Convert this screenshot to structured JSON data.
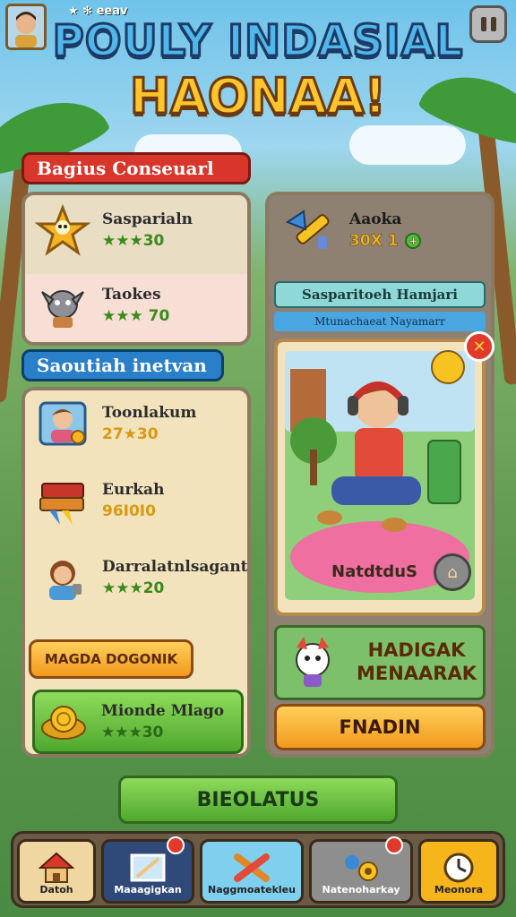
{
  "header": {
    "badge_text": "★ ✻ eeav",
    "title_line1": "POULY INDASIAL",
    "title_line2": "HAONAA!"
  },
  "left_panel": {
    "ribbon1": "Bagius Conseuarl",
    "items_top": [
      {
        "name": "Sasparialn",
        "stat": "★★★30",
        "icon": "star-creature-icon"
      },
      {
        "name": "Taokes",
        "stat": "★★★ 70",
        "icon": "goat-icon"
      }
    ],
    "ribbon2": "Saoutiah inetvan",
    "items_bottom": [
      {
        "name": "Toonlakum",
        "stat": "27★30",
        "icon": "boy-portrait-icon"
      },
      {
        "name": "Eurkah",
        "stat": "96I0I0",
        "icon": "book-stack-icon"
      },
      {
        "name": "Darralatnlsagant",
        "stat": "★★★20",
        "icon": "girl-portrait-icon"
      }
    ],
    "button_label": "MAGDA DOGONIK",
    "reward": {
      "name": "Mionde Mlago",
      "stat": "★★★30",
      "icon": "gold-coins-icon"
    }
  },
  "right_panel": {
    "item": {
      "name": "Aaoka",
      "stat": "30X 1",
      "icon": "telescope-icon"
    },
    "banner_title": "Sasparitoeh Hamjari",
    "banner_sub": "Mtunachaeat Nayamarr",
    "card_caption": "NatdtduS",
    "promo_text_line1": "HADIGAK",
    "promo_text_line2": "MENAARAK",
    "action_button": "FNADIN"
  },
  "center_button": "BIEOLATUS",
  "bottom_nav": [
    {
      "label": "Datoh",
      "icon": "house-icon"
    },
    {
      "label": "Maaagigkan",
      "icon": "painting-icon"
    },
    {
      "label": "Naggmoatekleu",
      "icon": "crossed-tools-icon"
    },
    {
      "label": "Natenoharkay",
      "icon": "gadgets-icon"
    },
    {
      "label": "Meonora",
      "icon": "clock-icon"
    }
  ],
  "colors": {
    "ribbon_red": "#d8362a",
    "ribbon_blue": "#2a7fc9",
    "accent_green": "#4fa82e",
    "accent_orange": "#f29a1d",
    "title_blue": "#4fb7ea",
    "title_gold": "#ffc52b"
  }
}
